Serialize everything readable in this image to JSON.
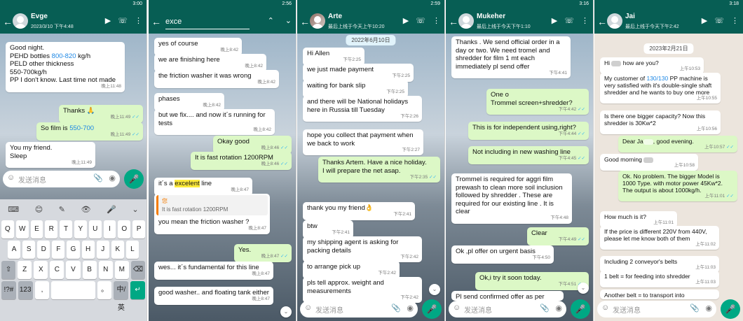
{
  "p1": {
    "status_left": "",
    "status_right": "3:00",
    "name": "Evge",
    "sub": "2023/3/10 下午4:48",
    "msgs": [
      {
        "text": "Good night.\nPEHD bottles 800-820 kg/h\nPELD other thickness\n550-700kg/h\nPP I don't know. Last time not made",
        "time": "晚上11:48"
      },
      {
        "text": "Thanks 🙏",
        "time": "晚上11:49"
      },
      {
        "text": "So film is 550-700",
        "time": "晚上11:49"
      },
      {
        "text": "You my friend.\nSleep",
        "time": "晚上11:49"
      }
    ],
    "input_placeholder": "发送消息",
    "kb_row1": [
      "Q",
      "W",
      "E",
      "R",
      "T",
      "Y",
      "U",
      "I",
      "O",
      "P"
    ],
    "kb_row2": [
      "A",
      "S",
      "D",
      "F",
      "G",
      "H",
      "J",
      "K",
      "L"
    ],
    "kb_row3": [
      "⇧",
      "Z",
      "X",
      "C",
      "V",
      "B",
      "N",
      "M",
      "⌫"
    ],
    "kb_row4": [
      "!?#",
      "123",
      ",",
      "",
      "。",
      "中/英",
      "↵"
    ],
    "kb_tools": [
      "⌨",
      "😊",
      "✎",
      "👁",
      "🎤",
      "⌄"
    ]
  },
  "p2": {
    "status_right": "2:56",
    "search": "exce",
    "msgs": [
      {
        "text": "yes of course",
        "time": "晚上8:42"
      },
      {
        "text": "we are finishing here",
        "time": "晚上8:42"
      },
      {
        "text": "the friction washer it was wrong",
        "time": "晚上8:42"
      },
      {
        "text": "phases",
        "time": "晚上8:42"
      },
      {
        "text": "but we fix.... and now it´s running for tests",
        "time": "晚上8:42"
      },
      {
        "text": "Okay good",
        "time": "晚上8:46"
      },
      {
        "text": "It is fast rotation 1200RPM",
        "time": "晚上8:46"
      },
      {
        "text_a": "it´s a ",
        "text_hl": "excelent",
        "text_b": " line",
        "time": "晚上8:47"
      },
      {
        "quote_name": "您",
        "quote_text": "It is fast rotation 1200RPM",
        "text": "you mean the friction washer ?",
        "time": "晚上8:47"
      },
      {
        "text": "Yes.",
        "time": "晚上8:47"
      },
      {
        "text": "wes... it´s fundamental for this line",
        "time": "晚上8:47"
      },
      {
        "text": "good washer.. and floating tank either",
        "time": "晚上8:47"
      }
    ]
  },
  "p3": {
    "status_right": "2:59",
    "name": "Arte",
    "sub": "最后上线于今天上午10:20",
    "date": "2022年6月10日",
    "msgs": [
      {
        "text": "Hi Allen",
        "time": "下午2:25"
      },
      {
        "text": "we just made payment",
        "time": "下午2:25"
      },
      {
        "text": "waiting for bank slip",
        "time": "下午2:25"
      },
      {
        "text": "and there will be National holidays here in Russia till Tuesday",
        "time": "下午2:26"
      },
      {
        "text": "hope you collect that payment when we back to work",
        "time": "下午2:27"
      },
      {
        "text": "Thanks Artem. Have a nice holiday.\nI will prepare the net asap.",
        "time": "下午2:35"
      },
      {
        "text": "thank you my friend👌",
        "time": "下午2:41"
      },
      {
        "text": "btw",
        "time": "下午2:41"
      },
      {
        "text": "my shipping agent is asking for packing details",
        "time": "下午2:42"
      },
      {
        "text": "to arrange pick up",
        "time": "下午2:42"
      },
      {
        "text": "pls tell approx. weight and measurements",
        "time": "下午2:42"
      }
    ],
    "input_placeholder": "发送消息"
  },
  "p4": {
    "status_right": "3:16",
    "name": "Mukeher",
    "sub": "最后上线于今天下午1:10",
    "msgs": [
      {
        "text": "Thanks . We send official order in a day or two.  We need tromel and shredder for film 1 mt each immediately pl send offer",
        "time": "下午4:41"
      },
      {
        "text": "One o\nTrommel screen+shredder?",
        "time": "下午4:42"
      },
      {
        "text": "This is for independent using,right?",
        "time": "下午4:44"
      },
      {
        "text": "Not including in new washing line",
        "time": "下午4:45"
      },
      {
        "text": "Trommel is required for aggri film prewash to clean more soil inclusion followed by shredder . These are required for our existing line . It is clear",
        "time": "下午4:48"
      },
      {
        "text": "Clear",
        "time": "下午4:49"
      },
      {
        "text": "Ok ,pl offer on urgent basis",
        "time": "下午4:50"
      },
      {
        "text": "Ok,i try it soon today.",
        "time": "下午4:51"
      },
      {
        "text": "Pl send confirmed offer as per",
        "time": ""
      }
    ],
    "input_placeholder": "发送消息"
  },
  "p5": {
    "status_right": "3:18",
    "name": "Jai",
    "sub": "最后上线于今天下午2:42",
    "date": "2023年2月21日",
    "msgs": [
      {
        "text_a": "Hi ",
        "text_b": " how are you?",
        "time": "上午10:53"
      },
      {
        "text_a": "My customer of ",
        "text_hl": "130/130",
        "text_b": " PP machine is very satisfied with it's double-single shaft shredder and he wants to buy one more",
        "time": "上午10:55"
      },
      {
        "text": "Is there one bigger capacity? Now this shredder is 30Kw*2",
        "time": "上午10:56"
      },
      {
        "text_a": "Dear Ja",
        "text_b": ", good evening.",
        "time": "上午10:57"
      },
      {
        "text_a": "Good morning ",
        "text_b": "",
        "time": "上午10:58"
      },
      {
        "text": "Ok. No problem. The bigger Model is 1000 Type. with motor power 45Kw*2. The output is about 1000kg/h.",
        "time": "上午11:01"
      },
      {
        "text": "How much is it?",
        "time": "上午11:01"
      },
      {
        "text": "If the price is different 220V from 440V, please let me know both of them",
        "time": "上午11:02"
      },
      {
        "text": "Including 2 conveyor's belts",
        "time": "上午11:03"
      },
      {
        "text": "1 belt = for feeding into shredder",
        "time": "上午11:03"
      },
      {
        "text": "Another belt = to transport into",
        "time": ""
      }
    ],
    "input_placeholder": "发送消息"
  }
}
